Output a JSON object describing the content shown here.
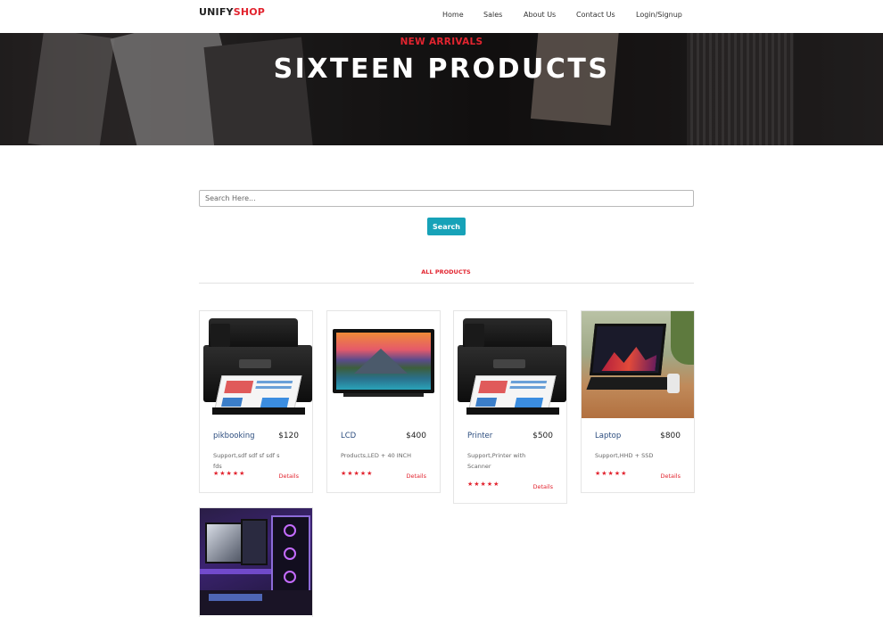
{
  "header": {
    "logo_part1": "UNIFY",
    "logo_part2": "SHOP",
    "nav": [
      "Home",
      "Sales",
      "About Us",
      "Contact Us",
      "Login/Signup"
    ]
  },
  "hero": {
    "subtitle": "NEW ARRIVALS",
    "title": "SIXTEEN PRODUCTS"
  },
  "search": {
    "placeholder": "Search Here...",
    "button_label": "Search"
  },
  "section_label": "ALL PRODUCTS",
  "products": [
    {
      "name": "pikbooking",
      "price": "$120",
      "desc": "Support,sdf sdf sf sdf s fds",
      "stars": "★★★★★",
      "details": "Details",
      "image": "printer"
    },
    {
      "name": "LCD",
      "price": "$400",
      "desc": "Products,LED + 40 INCH",
      "stars": "★★★★★",
      "details": "Details",
      "image": "tv"
    },
    {
      "name": "Printer",
      "price": "$500",
      "desc": "Support,Printer with Scanner",
      "stars": "★★★★★",
      "details": "Details",
      "image": "printer"
    },
    {
      "name": "Laptop",
      "price": "$800",
      "desc": "Support,HHD + SSD",
      "stars": "★★★★★",
      "details": "Details",
      "image": "laptop"
    },
    {
      "name": "",
      "price": "",
      "desc": "",
      "stars": "",
      "details": "",
      "image": "gaming-pc"
    }
  ],
  "colors": {
    "brand_red": "#e2242f",
    "button_teal": "#17a2b8",
    "product_name_blue": "#2b4c7e"
  }
}
